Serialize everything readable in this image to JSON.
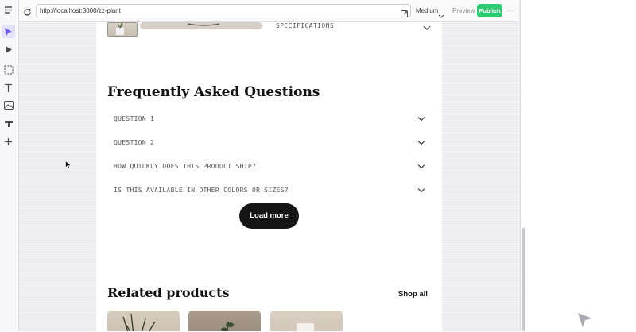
{
  "browser": {
    "url": "http://localhost:3000/zz-plant",
    "device": "Medium",
    "preview_label": "Preview",
    "publish_label": "Publish",
    "more": "···"
  },
  "page": {
    "specifications_label": "SPECIFICATIONS",
    "faq_title": "Frequently Asked Questions",
    "faq_items": [
      {
        "question": "QUESTION 1"
      },
      {
        "question": "QUESTION 2"
      },
      {
        "question": "HOW QUICKLY DOES THIS PRODUCT SHIP?"
      },
      {
        "question": "IS THIS AVAILABLE IN OTHER COLORS OR SIZES?"
      }
    ],
    "load_more_label": "Load more",
    "related_title": "Related products",
    "shop_all_label": "Shop all"
  },
  "icons": {
    "tools": [
      "select-arrow-icon",
      "play-icon",
      "marquee-select-icon",
      "text-tool-icon",
      "image-tool-icon",
      "component-icon",
      "add-icon"
    ],
    "toolbar": [
      "refresh-icon",
      "open-external-icon",
      "chevron-down-icon"
    ]
  },
  "colors": {
    "accent": "#6b5cf6",
    "publish": "#2ecc71",
    "button_dark": "#151515"
  }
}
